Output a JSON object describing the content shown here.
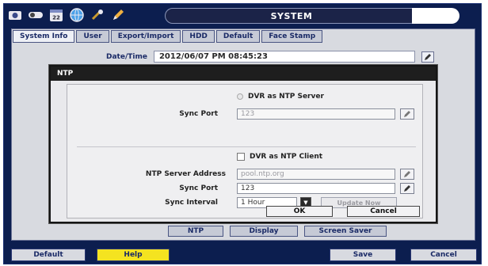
{
  "title": "SYSTEM",
  "top_icons": [
    "camera-icon",
    "toggle-icon",
    "calendar-icon",
    "globe-icon",
    "tools-icon",
    "pencil-icon"
  ],
  "calendar_badge": "22",
  "tabs": [
    "System Info",
    "User",
    "Export/Import",
    "HDD",
    "Default",
    "Face Stamp"
  ],
  "date_label": "Date/Time",
  "date_value": "2012/06/07 PM 08:45:23",
  "modal": {
    "title": "NTP",
    "server_label": "DVR as NTP Server",
    "server_sync_label": "Sync Port",
    "server_sync_value": "123",
    "client_label": "DVR as NTP Client",
    "ntp_address_label": "NTP Server Address",
    "ntp_address_value": "pool.ntp.org",
    "client_sync_label": "Sync Port",
    "client_sync_value": "123",
    "interval_label": "Sync Interval",
    "interval_value": "1 Hour",
    "update_now": "Update Now",
    "ok": "OK",
    "cancel": "Cancel"
  },
  "bottom_tabs": [
    "NTP",
    "Display",
    "Screen Saver"
  ],
  "footer": {
    "default": "Default",
    "help": "Help",
    "save": "Save",
    "cancel": "Cancel"
  },
  "colors": {
    "frame": "#0c1e4f",
    "help": "#f4e320",
    "panel": "#d8dae0"
  }
}
